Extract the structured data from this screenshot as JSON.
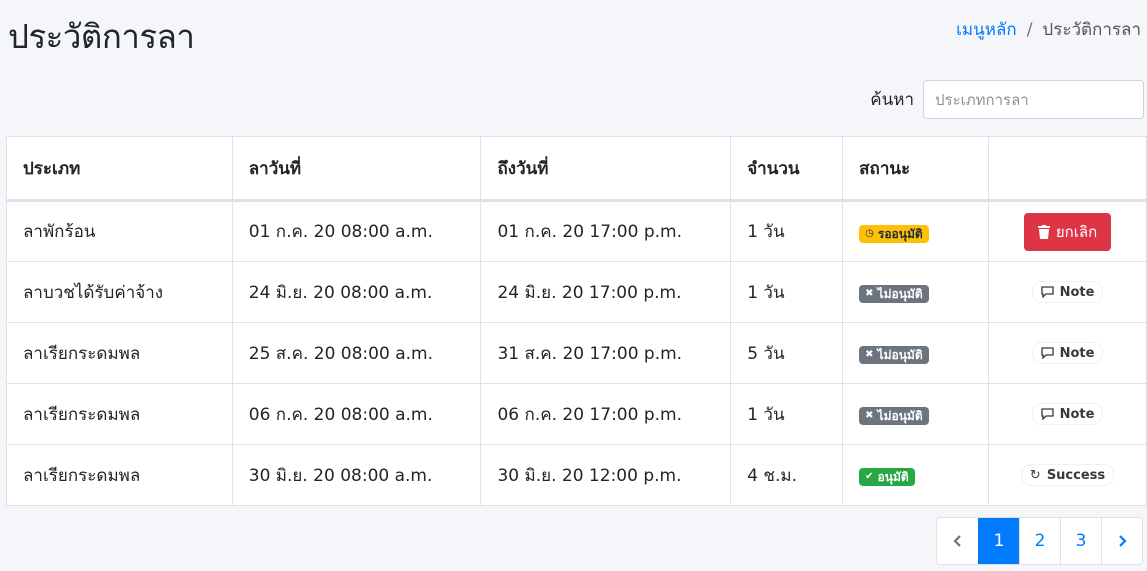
{
  "header": {
    "title": "ประวัติการลา",
    "breadcrumb": {
      "home": "เมนูหลัก",
      "separator": "/",
      "current": "ประวัติการลา"
    }
  },
  "search": {
    "label": "ค้นหา",
    "placeholder": "ประเภทการลา",
    "value": ""
  },
  "table": {
    "columns": [
      "ประเภท",
      "ลาวันที่",
      "ถึงวันที่",
      "จำนวน",
      "สถานะ",
      ""
    ],
    "rows": [
      {
        "type": "ลาพักร้อน",
        "from": "01 ก.ค. 20 08:00 a.m.",
        "to": "01 ก.ค. 20 17:00 p.m.",
        "amount": "1 วัน",
        "status": "รออนุมัติ",
        "status_icon": "clock-icon",
        "action": "ยกเลิก",
        "action_icon": "trash-icon"
      },
      {
        "type": "ลาบวชได้รับค่าจ้าง",
        "from": "24 มิ.ย. 20 08:00 a.m.",
        "to": "24 มิ.ย. 20 17:00 p.m.",
        "amount": "1 วัน",
        "status": "ไม่อนุมัติ",
        "status_icon": "x-icon",
        "action": "Note",
        "action_icon": "comment-icon"
      },
      {
        "type": "ลาเรียกระดมพล",
        "from": "25 ส.ค. 20 08:00 a.m.",
        "to": "31 ส.ค. 20 17:00 p.m.",
        "amount": "5 วัน",
        "status": "ไม่อนุมัติ",
        "status_icon": "x-icon",
        "action": "Note",
        "action_icon": "comment-icon"
      },
      {
        "type": "ลาเรียกระดมพล",
        "from": "06 ก.ค. 20 08:00 a.m.",
        "to": "06 ก.ค. 20 17:00 p.m.",
        "amount": "1 วัน",
        "status": "ไม่อนุมัติ",
        "status_icon": "x-icon",
        "action": "Note",
        "action_icon": "comment-icon"
      },
      {
        "type": "ลาเรียกระดมพล",
        "from": "30 มิ.ย. 20 08:00 a.m.",
        "to": "30 มิ.ย. 20 12:00 p.m.",
        "amount": "4 ช.ม.",
        "status": "อนุมัติ",
        "status_icon": "check-icon",
        "action": "Success",
        "action_icon": "sync-icon"
      }
    ]
  },
  "pagination": {
    "pages": [
      "1",
      "2",
      "3"
    ],
    "current": "1",
    "prev_icon": "chevron-left-icon",
    "next_icon": "chevron-right-icon"
  },
  "colors": {
    "primary": "#007bff",
    "danger": "#dc3545",
    "warning": "#ffc107",
    "secondary": "#6c757d",
    "success": "#28a745"
  }
}
